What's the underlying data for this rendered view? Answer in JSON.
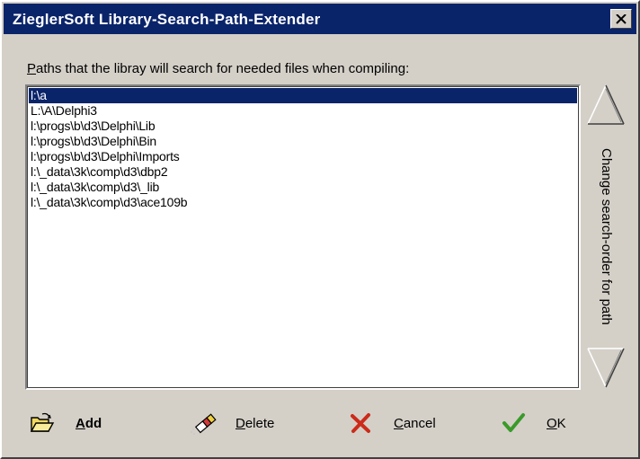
{
  "window": {
    "title": "ZieglerSoft Library-Search-Path-Extender",
    "close_glyph": "×"
  },
  "paths_label": {
    "mnemonic": "P",
    "rest": "aths that the libray will search for needed files when compiling:"
  },
  "paths": [
    "l:\\a",
    "L:\\A\\Delphi3",
    "l:\\progs\\b\\d3\\Delphi\\Lib",
    "l:\\progs\\b\\d3\\Delphi\\Bin",
    "l:\\progs\\b\\d3\\Delphi\\Imports",
    "l:\\_data\\3k\\comp\\d3\\dbp2",
    "l:\\_data\\3k\\comp\\d3\\_lib",
    "l:\\_data\\3k\\comp\\d3\\ace109b"
  ],
  "selected_index": 0,
  "order_label": "Change search-order for path",
  "buttons": {
    "add": {
      "mnemonic": "A",
      "rest": "dd",
      "icon": "open-folder-icon"
    },
    "delete": {
      "mnemonic": "D",
      "rest": "elete",
      "icon": "eraser-icon"
    },
    "cancel": {
      "mnemonic": "C",
      "rest": "ancel",
      "icon": "red-x-icon"
    },
    "ok": {
      "mnemonic": "O",
      "rest": "K",
      "icon": "green-check-icon"
    }
  },
  "colors": {
    "titlebar": "#0a246a",
    "selection": "#0a246a",
    "face": "#d4d0c8",
    "cancel_red": "#cc2a1a",
    "ok_green": "#3a9a2a"
  }
}
